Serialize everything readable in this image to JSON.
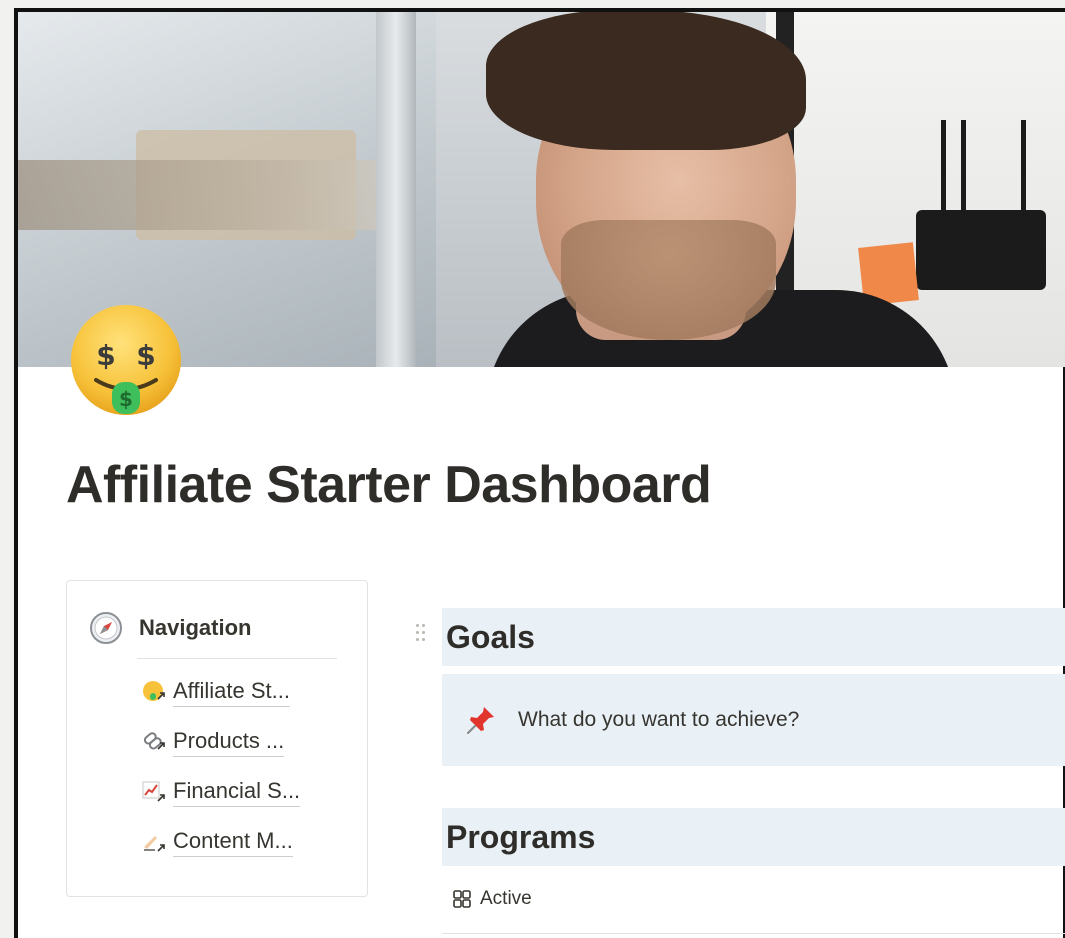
{
  "page": {
    "title": "Affiliate Starter Dashboard",
    "icon": "money-mouth-face-icon"
  },
  "navigation": {
    "heading": "Navigation",
    "heading_icon": "compass-icon",
    "items": [
      {
        "label": "Affiliate St...",
        "icon": "money-mouth-link-icon"
      },
      {
        "label": "Products ...",
        "icon": "chain-link-icon"
      },
      {
        "label": "Financial S...",
        "icon": "chart-increasing-icon"
      },
      {
        "label": "Content M...",
        "icon": "writing-hand-icon"
      }
    ]
  },
  "goals": {
    "heading": "Goals",
    "callout_icon": "pushpin-icon",
    "callout_text": "What do you want to achieve?"
  },
  "programs": {
    "heading": "Programs",
    "view_icon": "gallery-view-icon",
    "view_label": "Active"
  },
  "colors": {
    "block_background": "#e9f1f7",
    "text": "#37352f",
    "border": "#e3e2e0"
  }
}
